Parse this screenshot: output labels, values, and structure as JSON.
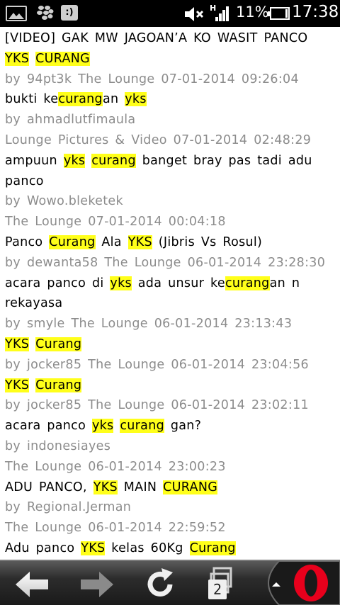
{
  "status_bar": {
    "icons": [
      "gallery-icon",
      "blackberry-messenger-icon",
      "chat-icon",
      "mute-icon",
      "signal-icon",
      "battery-icon"
    ],
    "chat_glyph": ":)",
    "network": "H",
    "battery": "11%",
    "clock": "17:38"
  },
  "results": [
    {
      "title": [
        {
          "t": "[VIDEO]  GAK  MW  JAGOAN’A  KO  WASIT  PANCO"
        }
      ],
      "title2": [
        {
          "t": "YKS",
          "h": true
        },
        {
          "t": " "
        },
        {
          "t": "CURANG",
          "h": true
        }
      ],
      "author": "94pt3k",
      "forum": "The Lounge",
      "date": "07-01-2014  09:26:04",
      "meta_inline": true
    },
    {
      "title": [
        {
          "t": "bukti  ke"
        },
        {
          "t": "curang",
          "h": true
        },
        {
          "t": "an  "
        },
        {
          "t": "yks",
          "h": true
        }
      ],
      "author": "ahmadlutfimaula",
      "forum": "Lounge Pictures & Video",
      "date": "07-01-2014  02:48:29"
    },
    {
      "title": [
        {
          "t": "ampuun "
        },
        {
          "t": "yks",
          "h": true
        },
        {
          "t": " "
        },
        {
          "t": "curang",
          "h": true
        },
        {
          "t": " banget  bray  pas  tadi  adu"
        }
      ],
      "title2": [
        {
          "t": "panco"
        }
      ],
      "author": "Wowo.bleketek",
      "forum": "The Lounge",
      "date": "07-01-2014  00:04:18"
    },
    {
      "title": [
        {
          "t": "Panco "
        },
        {
          "t": "Curang",
          "h": true
        },
        {
          "t": " Ala "
        },
        {
          "t": "YKS",
          "h": true
        },
        {
          "t": " (Jibris  Vs  Rosul)"
        }
      ],
      "author": "dewanta58",
      "forum": "The Lounge",
      "date": "06-01-2014  23:28:30",
      "meta_inline": true
    },
    {
      "title": [
        {
          "t": "acara  panco  di "
        },
        {
          "t": "yks",
          "h": true
        },
        {
          "t": " ada  unsur  ke"
        },
        {
          "t": "curang",
          "h": true
        },
        {
          "t": "an  n"
        }
      ],
      "title2": [
        {
          "t": "rekayasa"
        }
      ],
      "author": "smyle",
      "forum": "The Lounge",
      "date": "06-01-2014  23:13:43",
      "meta_inline": true
    },
    {
      "title": [
        {
          "t": "YKS",
          "h": true
        },
        {
          "t": " "
        },
        {
          "t": "Curang",
          "h": true
        }
      ],
      "author": "jocker85",
      "forum": "The Lounge",
      "date": "06-01-2014  23:04:56",
      "meta_inline": true
    },
    {
      "title": [
        {
          "t": "YKS",
          "h": true
        },
        {
          "t": " "
        },
        {
          "t": "Curang",
          "h": true
        }
      ],
      "author": "jocker85",
      "forum": "The Lounge",
      "date": "06-01-2014  23:02:11",
      "meta_inline": true
    },
    {
      "title": [
        {
          "t": "acara  panco "
        },
        {
          "t": "yks",
          "h": true
        },
        {
          "t": " "
        },
        {
          "t": "curang",
          "h": true
        },
        {
          "t": " gan?"
        }
      ],
      "author": "indonesiayes",
      "forum": "The Lounge",
      "date": "06-01-2014  23:00:23"
    },
    {
      "title": [
        {
          "t": "ADU  PANCO, "
        },
        {
          "t": "YKS",
          "h": true
        },
        {
          "t": " MAIN "
        },
        {
          "t": "CURANG",
          "h": true
        }
      ],
      "author": "Regional.Jerman",
      "forum": "The Lounge",
      "date": "06-01-2014  22:59:52"
    },
    {
      "title": [
        {
          "t": "Adu  panco "
        },
        {
          "t": "YKS",
          "h": true
        },
        {
          "t": " kelas  60Kg "
        },
        {
          "t": "Curang",
          "h": true
        }
      ]
    }
  ],
  "by_label": "by",
  "toolbar": {
    "back": "back-icon",
    "forward": "forward-icon",
    "reload": "reload-icon",
    "tabs_count": "2",
    "menu": "opera-menu-icon",
    "accent": "#e8001c"
  }
}
